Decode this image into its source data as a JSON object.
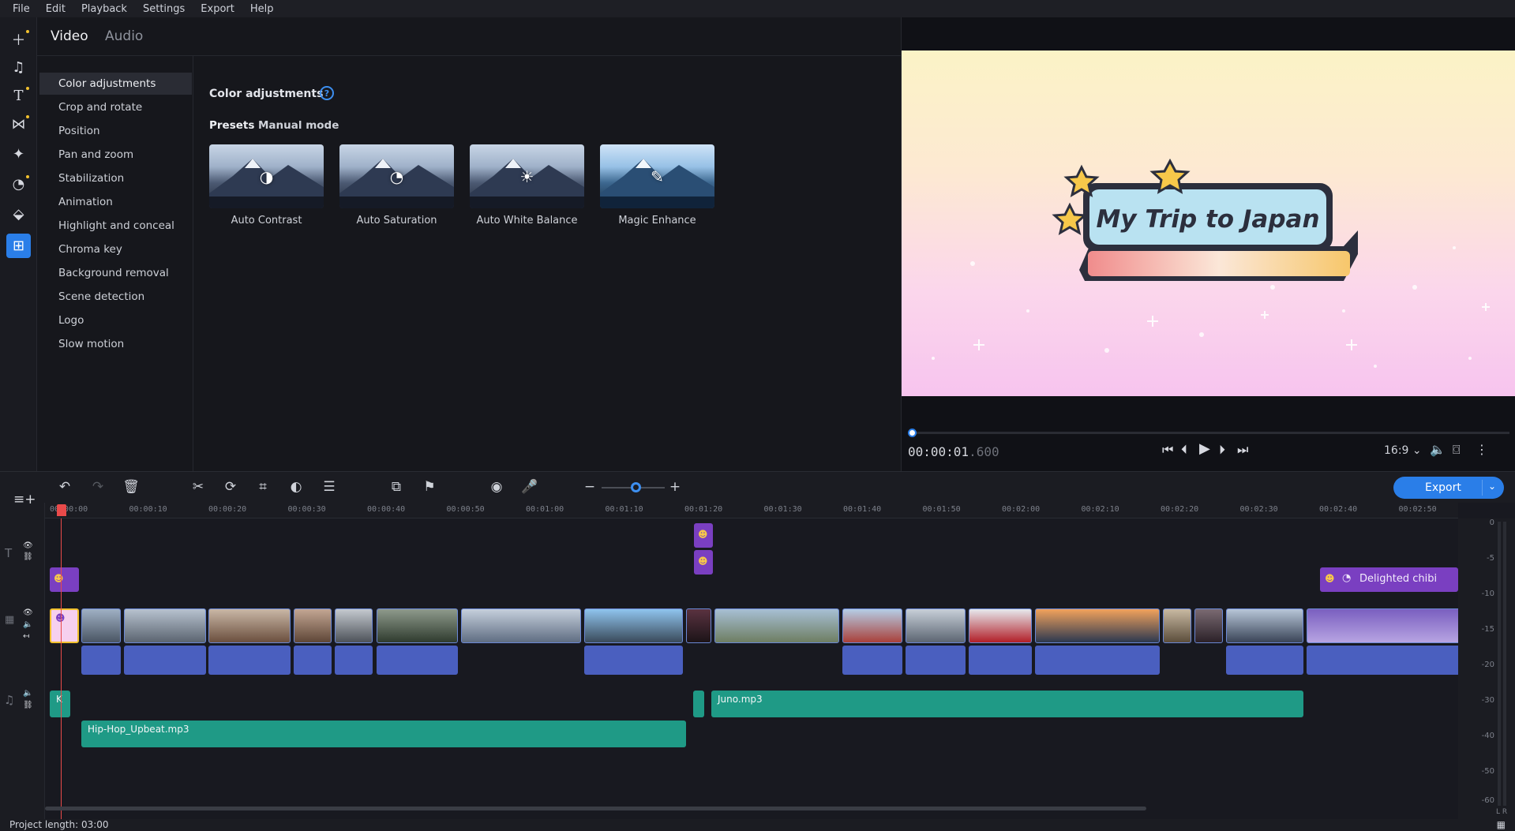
{
  "menu": [
    "File",
    "Edit",
    "Playback",
    "Settings",
    "Export",
    "Help"
  ],
  "rail_icons": [
    "add-media-icon",
    "music-icon",
    "text-icon",
    "transitions-icon",
    "filters-icon",
    "stickers-icon",
    "callouts-icon",
    "more-tools-icon"
  ],
  "tabs": {
    "video": "Video",
    "audio": "Audio"
  },
  "tools": [
    "Color adjustments",
    "Crop and rotate",
    "Position",
    "Pan and zoom",
    "Stabilization",
    "Animation",
    "Highlight and conceal",
    "Chroma key",
    "Background removal",
    "Scene detection",
    "Logo",
    "Slow motion"
  ],
  "settings": {
    "title": "Color adjustments",
    "help": "?",
    "mode_presets": "Presets",
    "mode_manual": "Manual mode",
    "presets": [
      {
        "label": "Auto Contrast",
        "icon": "contrast-icon"
      },
      {
        "label": "Auto Saturation",
        "icon": "saturation-icon"
      },
      {
        "label": "Auto White Balance",
        "icon": "white-balance-icon"
      },
      {
        "label": "Magic Enhance",
        "icon": "magic-wand-icon"
      }
    ]
  },
  "preview": {
    "title_text": "My Trip to Japan",
    "timecode_main": "00:00:01",
    "timecode_ms": ".600",
    "aspect": "16:9",
    "progress": 0.005
  },
  "toolbar": {
    "export_label": "Export"
  },
  "ruler": [
    "00:00:00",
    "00:00:10",
    "00:00:20",
    "00:00:30",
    "00:00:40",
    "00:00:50",
    "00:01:00",
    "00:01:10",
    "00:01:20",
    "00:01:30",
    "00:01:40",
    "00:01:50",
    "00:02:00",
    "00:02:10",
    "00:02:20",
    "00:02:30",
    "00:02:40",
    "00:02:50"
  ],
  "clips": {
    "title_right": "Delighted chibi",
    "audio_1": "Juno.mp3",
    "audio_2": "Hip-Hop_Upbeat.mp3",
    "audio_small": "K"
  },
  "meter": [
    "0",
    "-5",
    "-10",
    "-15",
    "-20",
    "-30",
    "-40",
    "-50",
    "-60"
  ],
  "meter_lr": "L R",
  "status": "Project length: 03:00",
  "colors": {
    "accent": "#2a7ee8",
    "title_clip": "#7a3fc1",
    "audio_clip": "#1f9a86",
    "video_audio": "#4a5fbf",
    "playhead": "#e94a4a"
  }
}
